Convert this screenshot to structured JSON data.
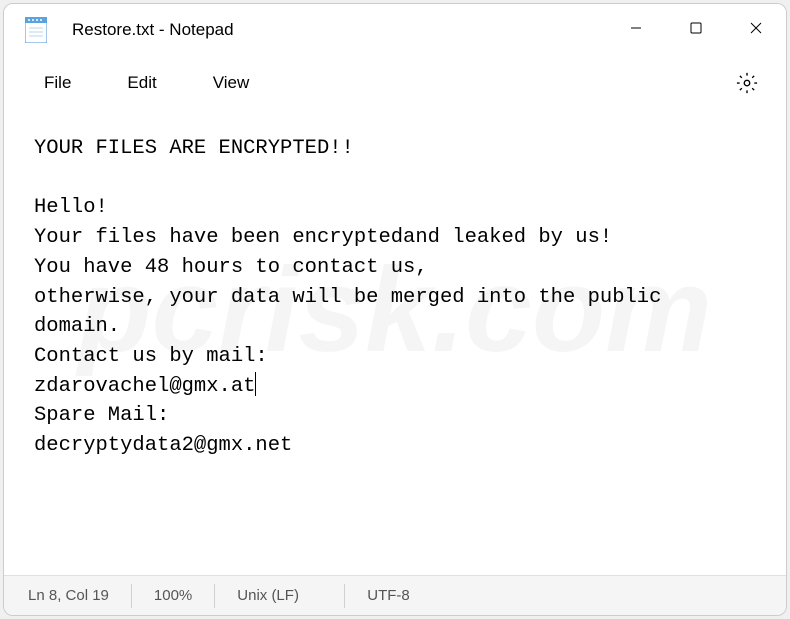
{
  "titlebar": {
    "title": "Restore.txt - Notepad"
  },
  "menubar": {
    "file": "File",
    "edit": "Edit",
    "view": "View"
  },
  "content": {
    "line1": "YOUR FILES ARE ENCRYPTED!!",
    "line2": "",
    "line3": "Hello!",
    "line4": "Your files have been encryptedand leaked by us!",
    "line5": "You have 48 hours to contact us,",
    "line6": "otherwise, your data will be merged into the public domain.",
    "line7": "Contact us by mail:",
    "line8": "zdarovachel@gmx.at",
    "line9": "Spare Mail:",
    "line10": "decryptydata2@gmx.net"
  },
  "statusbar": {
    "position": "Ln 8, Col 19",
    "zoom": "100%",
    "line_ending": "Unix (LF)",
    "encoding": "UTF-8"
  },
  "watermark": "pcrisk.com"
}
